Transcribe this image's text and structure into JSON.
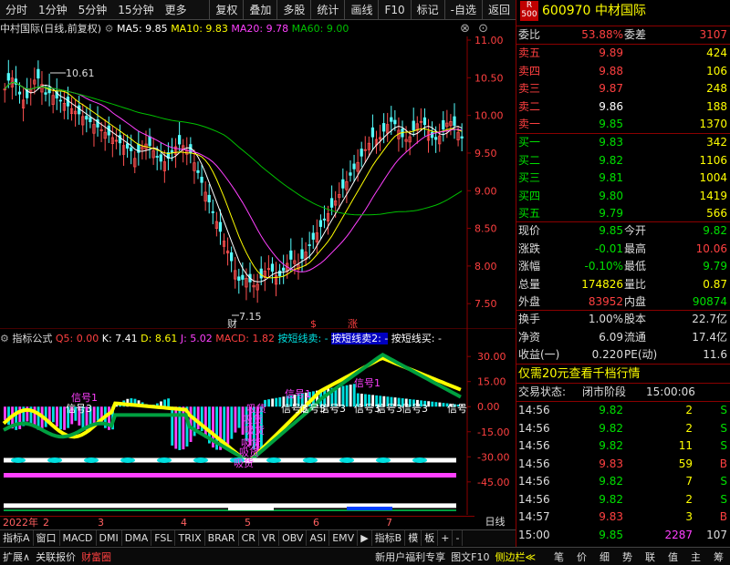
{
  "toolbar": {
    "left": [
      "分时",
      "1分钟",
      "5分钟",
      "15分钟",
      "更多"
    ],
    "right": [
      "复权",
      "叠加",
      "多股",
      "统计",
      "画线",
      "F10",
      "标记",
      "-自选",
      "返回"
    ]
  },
  "title": {
    "stock": "中村国际(日线,前复权)",
    "ma5": "MA5: 9.85",
    "ma10": "MA10: 9.83",
    "ma20": "MA20: 9.78",
    "ma60": "MA60: 9.00"
  },
  "main_chart": {
    "y_ticks": [
      "11.00",
      "10.50",
      "10.00",
      "9.50",
      "9.00",
      "8.50",
      "8.00",
      "7.50"
    ],
    "y_range": [
      7.2,
      11.0
    ],
    "high_label": "10.61",
    "low_label": "7.15",
    "markers": [
      "财",
      "$",
      "涨"
    ],
    "colors": {
      "ma5": "#ffffff",
      "ma10": "#ffff00",
      "ma20": "#ff40ff",
      "ma60": "#00c000",
      "up": "#ff5050",
      "down": "#54ffff"
    }
  },
  "sub_header": {
    "name": "指标公式",
    "q5": "Q5: 0.00",
    "k": "K: 7.41",
    "d": "D: 8.61",
    "j": "J: 5.02",
    "macd": "MACD: 1.82",
    "t1": "按短线卖: -",
    "t2": "按短线卖2: -",
    "t3": "按短线买: -"
  },
  "sub_chart": {
    "y_ticks": [
      "30.00",
      "15.00",
      "0.00",
      "-15.00",
      "-30.00",
      "-45.00"
    ],
    "labels": [
      "信号3",
      "信号3",
      "信号3",
      "信号3",
      "信号3",
      "信号3",
      "信号3",
      "信号"
    ],
    "pink_labels": [
      "信号1",
      "吸货",
      "吸货",
      "吸货",
      "吸货",
      "吸货",
      "吸货",
      "信号1",
      "信号1"
    ]
  },
  "date_axis": {
    "labels": [
      "2022年",
      "2",
      "3",
      "4",
      "5",
      "6",
      "7"
    ],
    "day_label": "日线"
  },
  "indicator_tabs": [
    "指标A",
    "窗口",
    "MACD",
    "DMI",
    "DMA",
    "FSL",
    "TRIX",
    "BRAR",
    "CR",
    "VR",
    "OBV",
    "ASI",
    "EMV",
    "指标B",
    "模",
    "板",
    "+",
    "-"
  ],
  "bottom_bar": {
    "left": [
      "扩展∧",
      "关联报价",
      "财富圈"
    ],
    "middle": [
      "新用户福利专享",
      "图文F10",
      "侧边栏≪"
    ],
    "right": [
      "笔",
      "价",
      "细",
      "势",
      "联",
      "值",
      "主",
      "筹"
    ]
  },
  "quote": {
    "code": "600970",
    "name": "中材国际",
    "badge_r": "R",
    "badge_n": "500",
    "webi_label": "委比",
    "webi": "53.88%",
    "weicha_label": "委差",
    "weicha": "3107",
    "sells": [
      {
        "label": "卖五",
        "price": "9.89",
        "vol": "424"
      },
      {
        "label": "卖四",
        "price": "9.88",
        "vol": "106"
      },
      {
        "label": "卖三",
        "price": "9.87",
        "vol": "248"
      },
      {
        "label": "卖二",
        "price": "9.86",
        "vol": "188"
      },
      {
        "label": "卖一",
        "price": "9.85",
        "vol": "1370"
      }
    ],
    "buys": [
      {
        "label": "买一",
        "price": "9.83",
        "vol": "342"
      },
      {
        "label": "买二",
        "price": "9.82",
        "vol": "1106"
      },
      {
        "label": "买三",
        "price": "9.81",
        "vol": "1004"
      },
      {
        "label": "买四",
        "price": "9.80",
        "vol": "1419"
      },
      {
        "label": "买五",
        "price": "9.79",
        "vol": "566"
      }
    ],
    "stats": [
      {
        "l1": "现价",
        "v1": "9.85",
        "c1": "green",
        "l2": "今开",
        "v2": "9.82",
        "c2": "green"
      },
      {
        "l1": "涨跌",
        "v1": "-0.01",
        "c1": "green",
        "l2": "最高",
        "v2": "10.06",
        "c2": "red"
      },
      {
        "l1": "涨幅",
        "v1": "-0.10%",
        "c1": "green",
        "l2": "最低",
        "v2": "9.79",
        "c2": "green"
      },
      {
        "l1": "总量",
        "v1": "174826",
        "c1": "yellow",
        "l2": "量比",
        "v2": "0.87",
        "c2": "yellow"
      },
      {
        "l1": "外盘",
        "v1": "83952",
        "c1": "red",
        "l2": "内盘",
        "v2": "90874",
        "c2": "green"
      }
    ],
    "stats2": [
      {
        "l1": "换手",
        "v1": "1.00%",
        "l2": "股本",
        "v2": "22.7亿"
      },
      {
        "l1": "净资",
        "v1": "6.09",
        "l2": "流通",
        "v2": "17.4亿"
      },
      {
        "l1": "收益(一)",
        "v1": "0.220",
        "l2": "PE(动)",
        "v2": "11.6"
      }
    ],
    "promo": "仅需20元查看千档行情",
    "status_label": "交易状态:",
    "status": "闭市阶段",
    "status_time": "15:00:06",
    "ticks": [
      {
        "t": "14:56",
        "p": "9.82",
        "v": "2",
        "s": "S"
      },
      {
        "t": "14:56",
        "p": "9.82",
        "v": "2",
        "s": "S"
      },
      {
        "t": "14:56",
        "p": "9.82",
        "v": "11",
        "s": "S"
      },
      {
        "t": "14:56",
        "p": "9.83",
        "v": "59",
        "s": "B"
      },
      {
        "t": "14:56",
        "p": "9.82",
        "v": "7",
        "s": "S"
      },
      {
        "t": "14:56",
        "p": "9.82",
        "v": "2",
        "s": "S"
      },
      {
        "t": "14:57",
        "p": "9.83",
        "v": "3",
        "s": "B"
      },
      {
        "t": "15:00",
        "p": "9.85",
        "v": "2287",
        "s": "107"
      }
    ]
  }
}
